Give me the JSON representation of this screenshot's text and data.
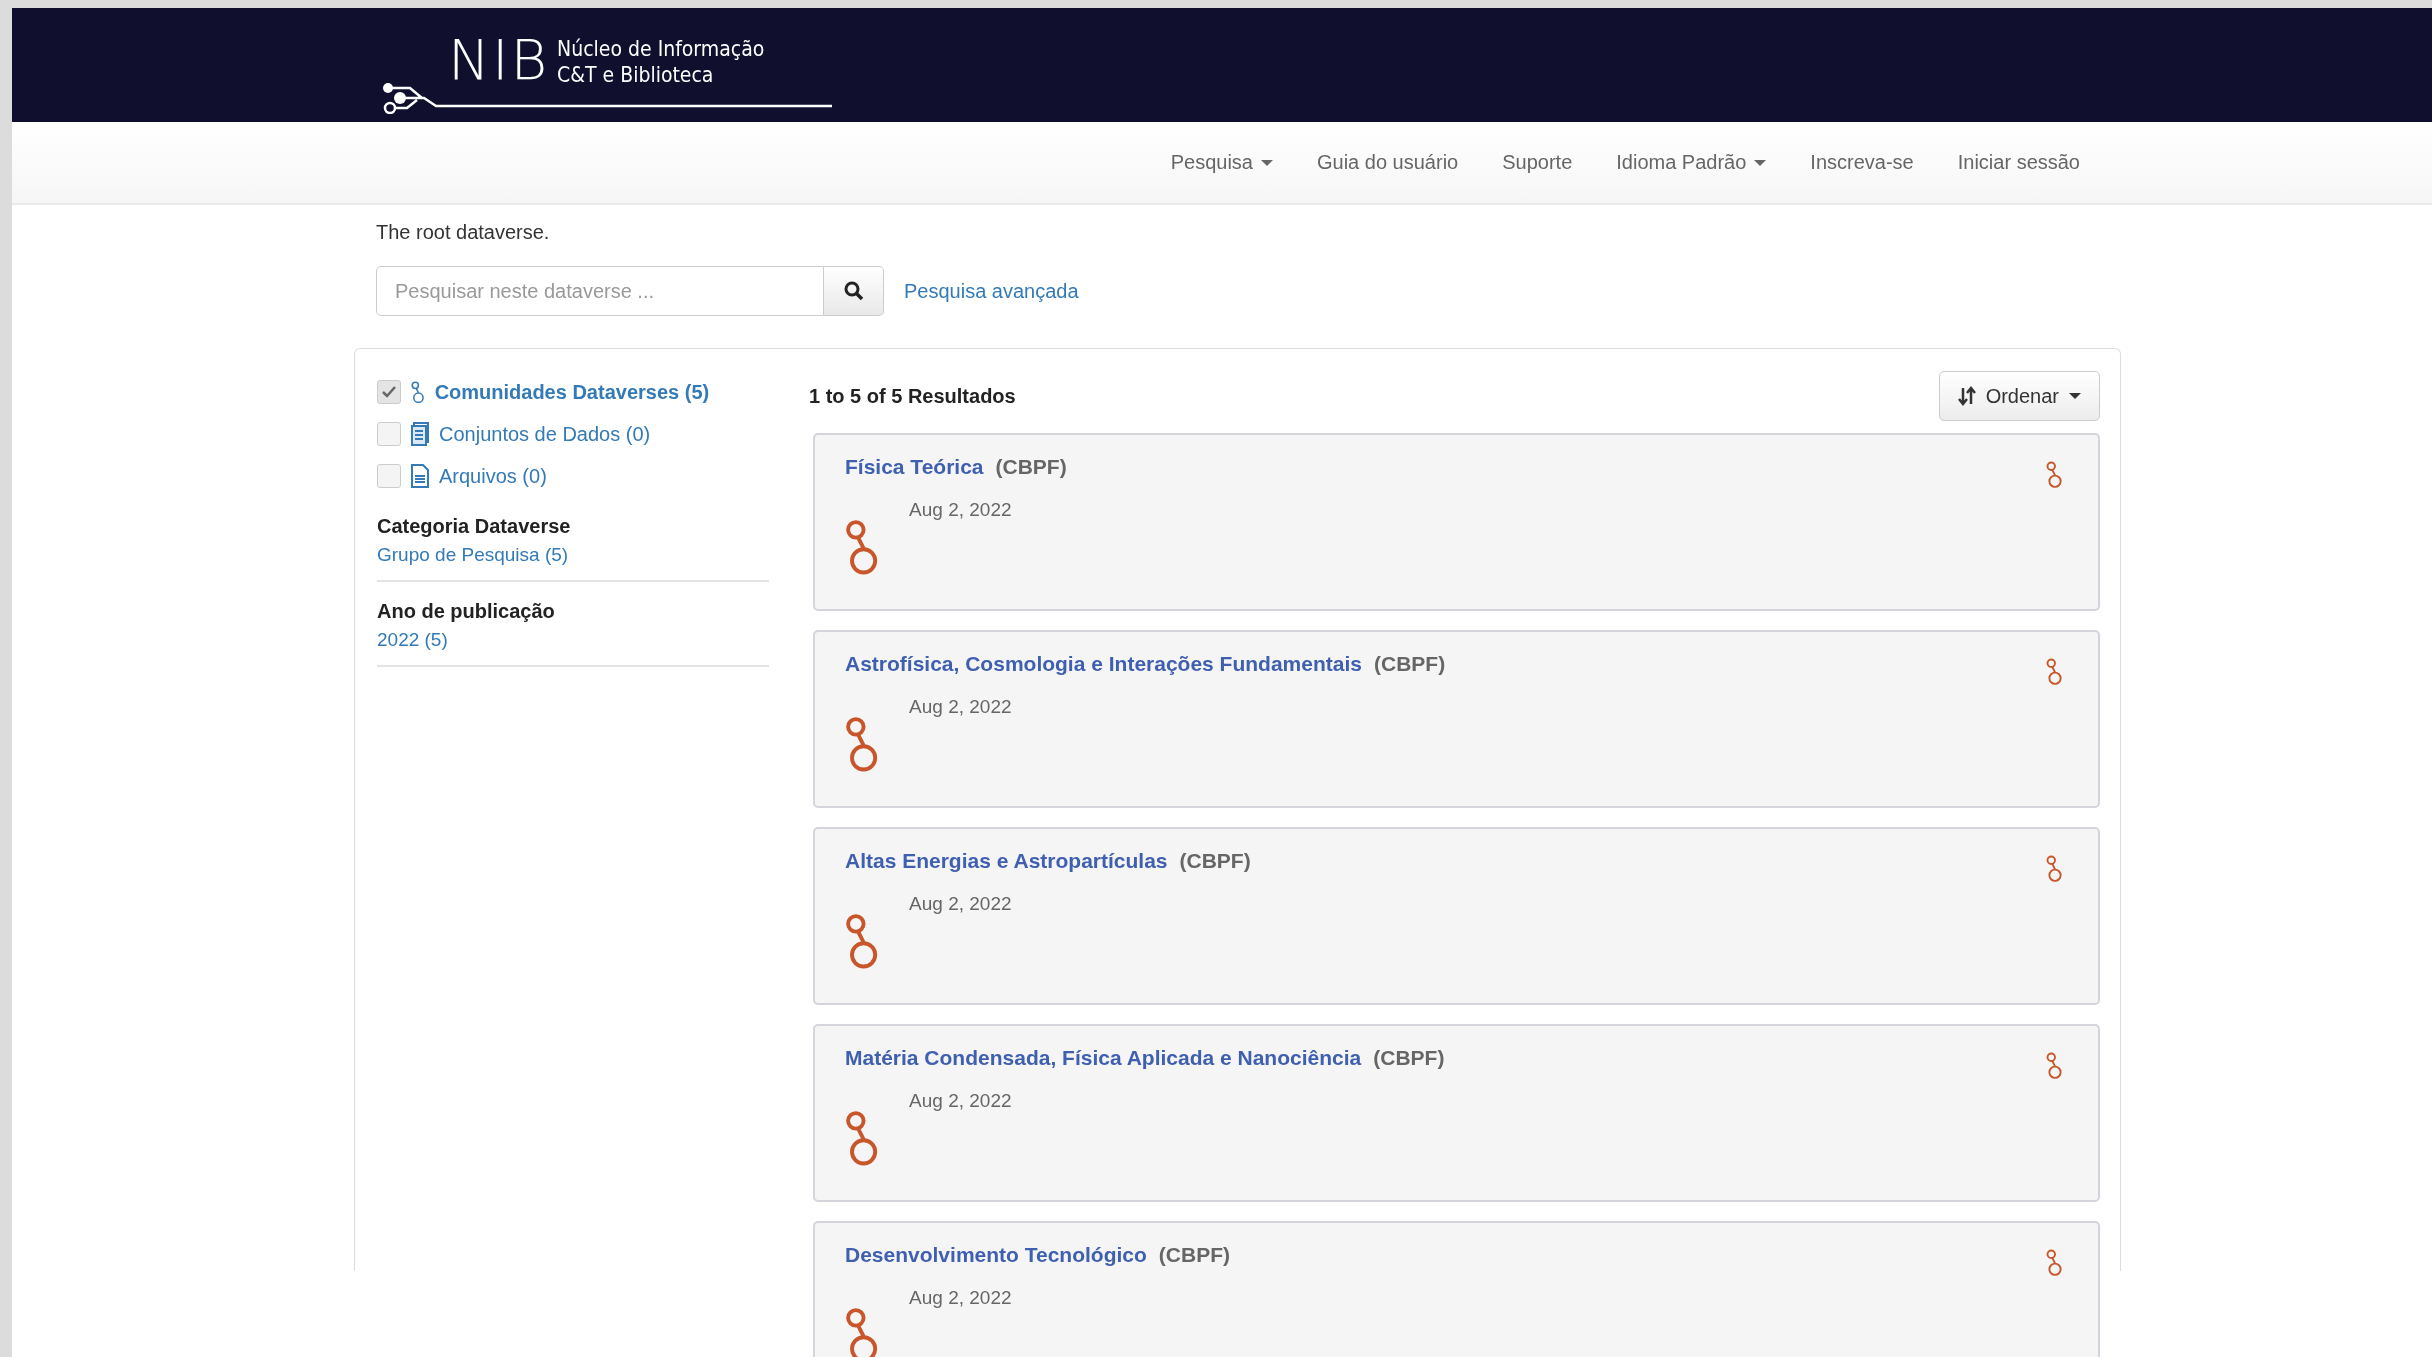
{
  "header": {
    "logo_mark": "NIB",
    "logo_line_1": "Núcleo de Informação",
    "logo_line_2": "C&T e Biblioteca"
  },
  "nav": [
    {
      "label": "Pesquisa",
      "dropdown": true
    },
    {
      "label": "Guia do usuário",
      "dropdown": false
    },
    {
      "label": "Suporte",
      "dropdown": false
    },
    {
      "label": "Idioma Padrão",
      "dropdown": true
    },
    {
      "label": "Inscreva-se",
      "dropdown": false
    },
    {
      "label": "Iniciar sessão",
      "dropdown": false
    }
  ],
  "description": "The root dataverse.",
  "search": {
    "placeholder": "Pesquisar neste dataverse ...",
    "advanced_link": "Pesquisa avançada"
  },
  "type_filters": [
    {
      "kind": "dataverse",
      "label": "Comunidades Dataverses (5)",
      "checked": true
    },
    {
      "kind": "dataset",
      "label": "Conjuntos de Dados (0)",
      "checked": false
    },
    {
      "kind": "file",
      "label": "Arquivos (0)",
      "checked": false
    }
  ],
  "facets": [
    {
      "title": "Categoria Dataverse",
      "values": [
        "Grupo de Pesquisa (5)"
      ]
    },
    {
      "title": "Ano de publicação",
      "values": [
        "2022 (5)"
      ]
    }
  ],
  "results_count": "1 to 5 of 5 Resultados",
  "sort_button": "Ordenar",
  "results": [
    {
      "title": "Física Teórica",
      "affiliation": "(CBPF)",
      "date": "Aug 2, 2022"
    },
    {
      "title": "Astrofísica, Cosmologia e Interações Fundamentais",
      "affiliation": "(CBPF)",
      "date": "Aug 2, 2022"
    },
    {
      "title": "Altas Energias e Astropartículas",
      "affiliation": "(CBPF)",
      "date": "Aug 2, 2022"
    },
    {
      "title": "Matéria Condensada, Física Aplicada e Nanociência",
      "affiliation": "(CBPF)",
      "date": "Aug 2, 2022"
    },
    {
      "title": "Desenvolvimento Tecnológico",
      "affiliation": "(CBPF)",
      "date": "Aug 2, 2022"
    }
  ]
}
